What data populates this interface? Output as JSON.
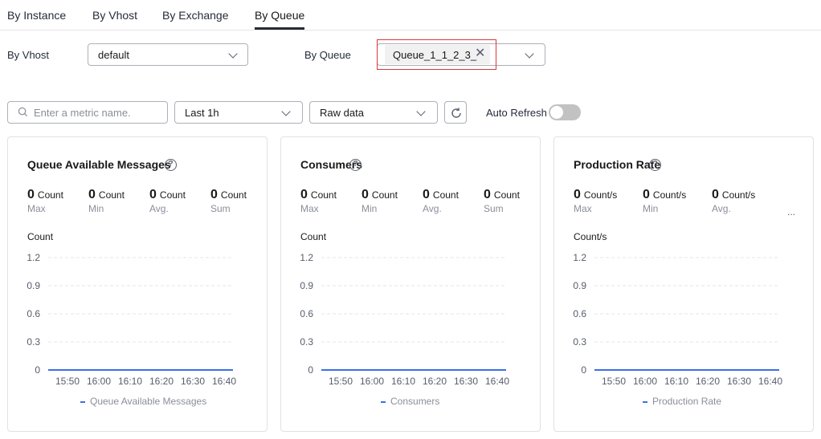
{
  "tabs": [
    {
      "label": "By Instance"
    },
    {
      "label": "By Vhost"
    },
    {
      "label": "By Exchange"
    },
    {
      "label": "By Queue",
      "active": true
    }
  ],
  "filters": {
    "vhost_label": "By Vhost",
    "vhost_value": "default",
    "queue_label": "By Queue",
    "queue_tag": "Queue_1_1_2_3_"
  },
  "toolbar": {
    "search_placeholder": "Enter a metric name.",
    "period_value": "Last 1h",
    "data_mode_value": "Raw data",
    "auto_refresh_label": "Auto Refresh",
    "auto_refresh_on": false
  },
  "colors": {
    "series": "#3c6fe8",
    "highlight_border": "#d9383a"
  },
  "cards": [
    {
      "title": "Queue Available Messages",
      "stats": [
        {
          "value": "0",
          "unit": "Count",
          "label": "Max"
        },
        {
          "value": "0",
          "unit": "Count",
          "label": "Min"
        },
        {
          "value": "0",
          "unit": "Count",
          "label": "Avg."
        },
        {
          "value": "0",
          "unit": "Count",
          "label": "Sum"
        }
      ],
      "chart_data": {
        "type": "line",
        "ylabel": "Count",
        "yticks": [
          "1.2",
          "0.9",
          "0.6",
          "0.3",
          "0"
        ],
        "ylim": [
          0,
          1.2
        ],
        "xticks": [
          "15:50",
          "16:00",
          "16:10",
          "16:20",
          "16:30",
          "16:40"
        ],
        "series": [
          {
            "name": "Queue Available Messages",
            "values": [
              0,
              0,
              0,
              0,
              0,
              0
            ]
          }
        ]
      }
    },
    {
      "title": "Consumers",
      "stats": [
        {
          "value": "0",
          "unit": "Count",
          "label": "Max"
        },
        {
          "value": "0",
          "unit": "Count",
          "label": "Min"
        },
        {
          "value": "0",
          "unit": "Count",
          "label": "Avg."
        },
        {
          "value": "0",
          "unit": "Count",
          "label": "Sum"
        }
      ],
      "chart_data": {
        "type": "line",
        "ylabel": "Count",
        "yticks": [
          "1.2",
          "0.9",
          "0.6",
          "0.3",
          "0"
        ],
        "ylim": [
          0,
          1.2
        ],
        "xticks": [
          "15:50",
          "16:00",
          "16:10",
          "16:20",
          "16:30",
          "16:40"
        ],
        "series": [
          {
            "name": "Consumers",
            "values": [
              0,
              0,
              0,
              0,
              0,
              0
            ]
          }
        ]
      }
    },
    {
      "title": "Production Rate",
      "stats": [
        {
          "value": "0",
          "unit": "Count/s",
          "label": "Max"
        },
        {
          "value": "0",
          "unit": "Count/s",
          "label": "Min"
        },
        {
          "value": "0",
          "unit": "Count/s",
          "label": "Avg."
        }
      ],
      "stats_more": "...",
      "chart_data": {
        "type": "line",
        "ylabel": "Count/s",
        "yticks": [
          "1.2",
          "0.9",
          "0.6",
          "0.3",
          "0"
        ],
        "ylim": [
          0,
          1.2
        ],
        "xticks": [
          "15:50",
          "16:00",
          "16:10",
          "16:20",
          "16:30",
          "16:40"
        ],
        "series": [
          {
            "name": "Production Rate",
            "values": [
              0,
              0,
              0,
              0,
              0,
              0
            ]
          }
        ]
      }
    }
  ]
}
